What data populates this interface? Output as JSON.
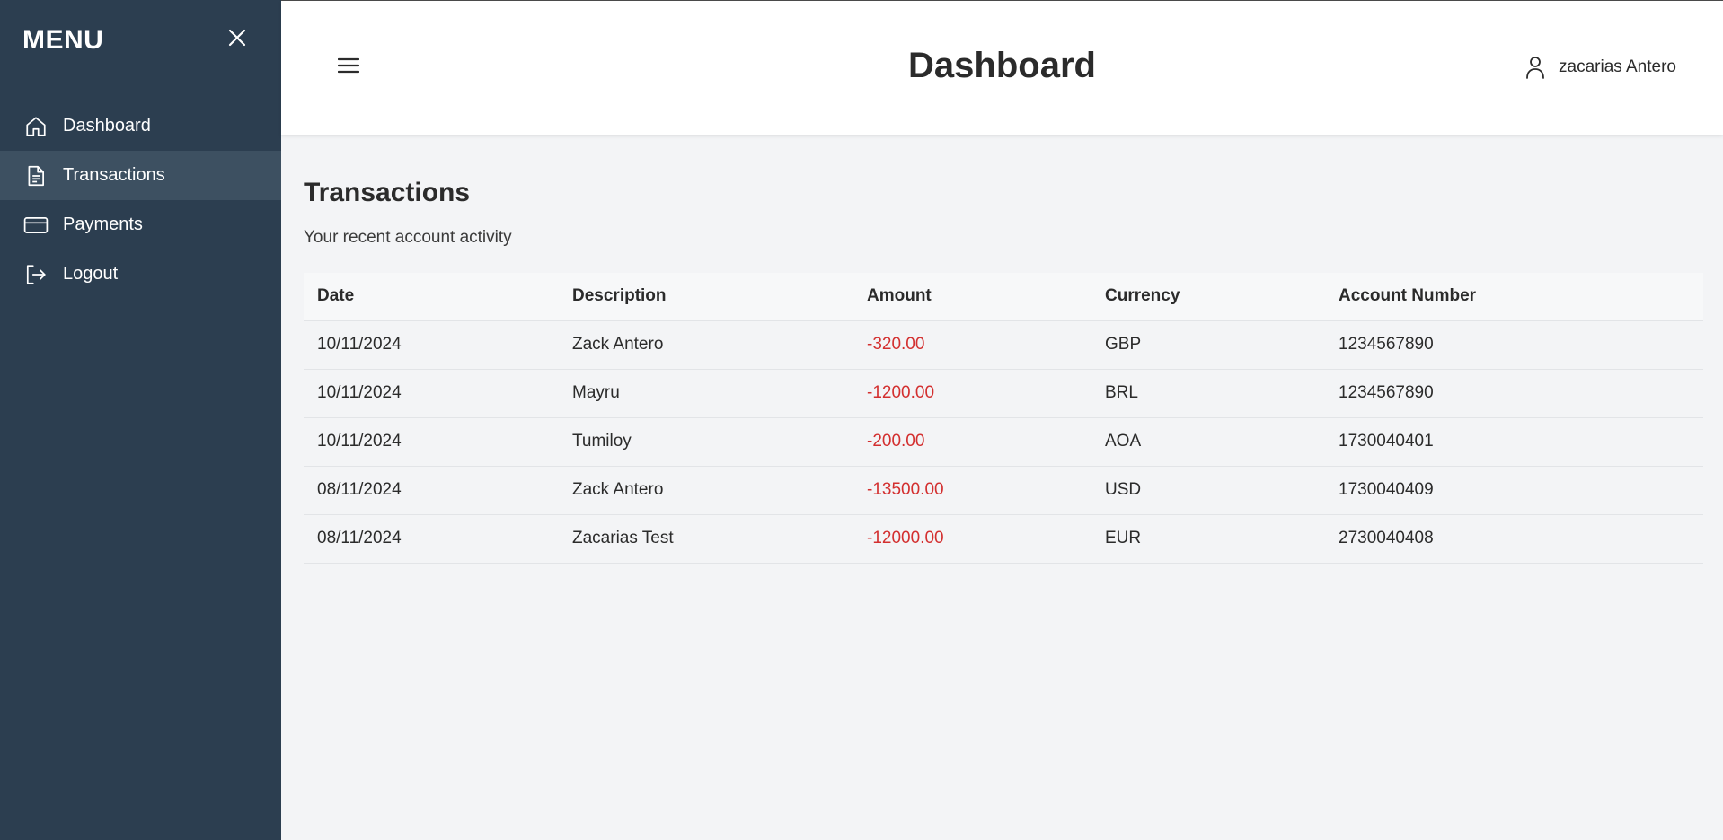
{
  "sidebar": {
    "title": "MENU",
    "items": [
      {
        "label": "Dashboard",
        "icon": "home-icon"
      },
      {
        "label": "Transactions",
        "icon": "document-icon",
        "active": true
      },
      {
        "label": "Payments",
        "icon": "credit-card-icon"
      },
      {
        "label": "Logout",
        "icon": "logout-icon"
      }
    ]
  },
  "header": {
    "title": "Dashboard",
    "user_name": "zacarias Antero"
  },
  "main": {
    "title": "Transactions",
    "subtitle": "Your recent account activity",
    "table": {
      "columns": [
        "Date",
        "Description",
        "Amount",
        "Currency",
        "Account Number"
      ],
      "rows": [
        {
          "date": "10/11/2024",
          "description": "Zack Antero",
          "amount": "-320.00",
          "currency": "GBP",
          "account": "1234567890"
        },
        {
          "date": "10/11/2024",
          "description": "Mayru",
          "amount": "-1200.00",
          "currency": "BRL",
          "account": "1234567890"
        },
        {
          "date": "10/11/2024",
          "description": "Tumiloy",
          "amount": "-200.00",
          "currency": "AOA",
          "account": "1730040401"
        },
        {
          "date": "08/11/2024",
          "description": "Zack Antero",
          "amount": "-13500.00",
          "currency": "USD",
          "account": "1730040409"
        },
        {
          "date": "08/11/2024",
          "description": "Zacarias Test",
          "amount": "-12000.00",
          "currency": "EUR",
          "account": "2730040408"
        }
      ]
    }
  },
  "colors": {
    "sidebar_bg": "#2c3e50",
    "sidebar_active": "#3d5061",
    "negative_amount": "#d32f2f",
    "page_bg": "#f3f4f6"
  }
}
